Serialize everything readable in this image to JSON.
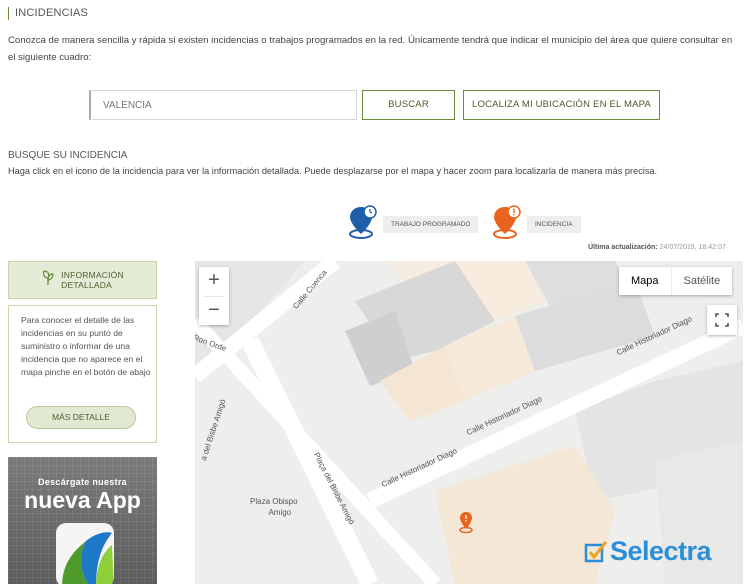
{
  "header": {
    "title": "INCIDENCIAS",
    "intro": "Conozca de manera sencilla y rápida si existen incidencias o trabajos programados en la red. Únicamente tendrá que indicar el municipio del área que quiere consultar en el siguiente cuadro:"
  },
  "search": {
    "value": "VALENCIA",
    "search_label": "BUSCAR",
    "locate_label": "LOCALIZA MI UBICACIÓN EN EL MAPA"
  },
  "incidents": {
    "title": "BUSQUE SU INCIDENCIA",
    "description": "Haga click en el icono de la incidencia para ver la información detallada. Puede desplazarse por el mapa y hacer zoom para localizarla de manera más precisa.",
    "legend": [
      {
        "label": "TRABAJO PROGRAMADO",
        "icon": "scheduled-work-pin-icon",
        "color": "#1f5fa8"
      },
      {
        "label": "INCIDENCIA",
        "icon": "incidence-pin-icon",
        "color": "#e8641c"
      }
    ],
    "last_update_label": "Última actualización:",
    "last_update_value": "24/07/2019, 18:42:07"
  },
  "sidebar": {
    "info_title_1": "INFORMACIÓN",
    "info_title_2": "DETALLADA",
    "info_text": "Para conocer el detalle de las incidencias en su punto de suministro o informar de una incidencia que no aparece en el mapa pinche en el botón de abajo",
    "more_label": "MÁS DETALLE",
    "app_line1": "Descárgate nuestra",
    "app_line2": "nueva App"
  },
  "map": {
    "zoom_in": "+",
    "zoom_out": "−",
    "type_map": "Mapa",
    "type_satellite": "Satélite",
    "streets": {
      "calle_cuenca": "Calle Cuenca",
      "ron_orde": "Ron Orde",
      "bisbe_amigo_left": "a del Bisbe Amigó",
      "bisbe_amigo_right": "Plaça del Bisbe Amigó",
      "historiador_diago_1": "Calle Historiador Diago",
      "historiador_diago_2": "Calle Historiador Diago",
      "historiador_diago_3": "Calle Historiador Diago",
      "plaza_1": "Plaza Obispo",
      "plaza_2": "Amigo"
    },
    "watermark": "Selectra"
  },
  "colors": {
    "accent": "#6a8a3c",
    "incidence": "#e8641c",
    "scheduled": "#1f5fa8",
    "watermark": "#2a8fd6"
  }
}
